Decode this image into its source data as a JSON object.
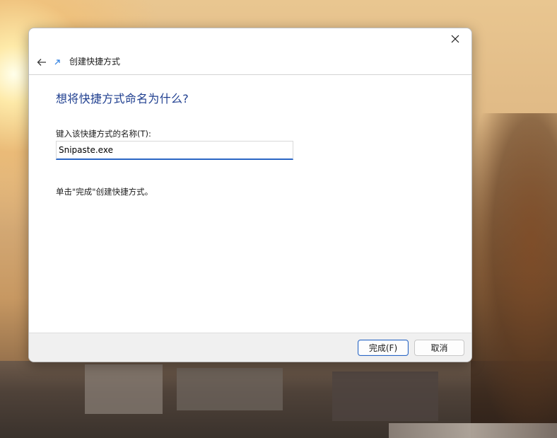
{
  "dialog": {
    "title": "创建快捷方式",
    "heading": "想将快捷方式命名为什么?",
    "name_label": "键入该快捷方式的名称(T):",
    "name_value": "Snipaste.exe",
    "hint": "单击\"完成\"创建快捷方式。",
    "finish_label": "完成(F)",
    "cancel_label": "取消"
  },
  "icons": {
    "close": "close-icon",
    "back": "back-arrow-icon",
    "app": "shortcut-icon"
  },
  "colors": {
    "heading": "#1e3e8f",
    "accent": "#2a66c4",
    "footer_bg": "#f0f0f0"
  }
}
